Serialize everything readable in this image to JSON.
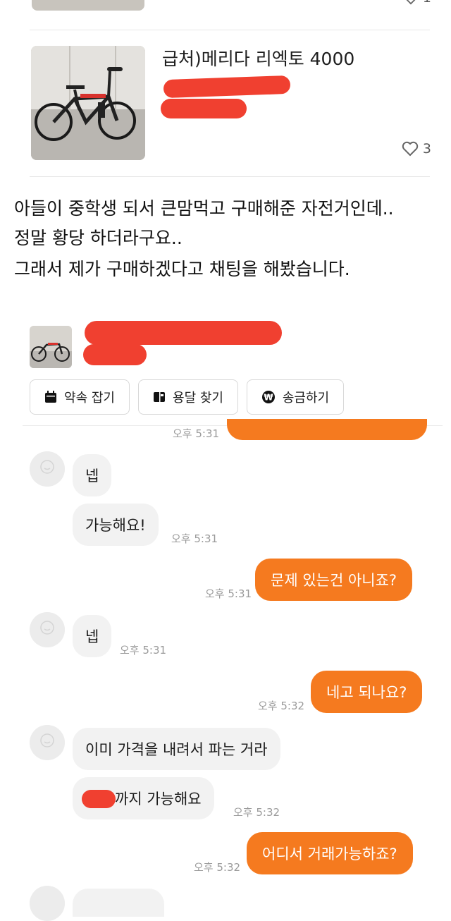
{
  "top_listing": {
    "likes": "1"
  },
  "listing": {
    "title": "급처)메리다 리엑토 4000",
    "likes": "3"
  },
  "caption": {
    "line1": "아들이 중학생 되서 큰맘먹고 구매해준 자전거인데..",
    "line2": "정말 황당 하더라구요..",
    "line3": "그래서 제가 구매하겠다고 채팅을 해봤습니다."
  },
  "chat_header": {
    "actions": [
      {
        "label": "약속 잡기",
        "icon": "calendar-icon"
      },
      {
        "label": "용달 찾기",
        "icon": "truck-icon"
      },
      {
        "label": "송금하기",
        "icon": "won-coin-icon"
      }
    ]
  },
  "chat": {
    "top_time": "오후 5:31",
    "messages": [
      {
        "side": "in",
        "text": "넵",
        "time": ""
      },
      {
        "side": "in",
        "text": "가능해요!",
        "time": "오후 5:31"
      },
      {
        "side": "out",
        "text": "문제 있는건 아니죠?",
        "time": "오후 5:31"
      },
      {
        "side": "in",
        "text": "넵",
        "time": "오후 5:31"
      },
      {
        "side": "out",
        "text": "네고 되나요?",
        "time": "오후 5:32"
      },
      {
        "side": "in",
        "text": "이미 가격을 내려서 파는 거라",
        "time": ""
      },
      {
        "side": "in",
        "text": "까지 가능해요",
        "time": "오후 5:32"
      },
      {
        "side": "out",
        "text": "어디서 거래가능하죠?",
        "time": "오후 5:32"
      }
    ]
  },
  "colors": {
    "accent": "#f57a1f",
    "redaction": "#f04030",
    "bubble_in": "#f2f2f2"
  }
}
